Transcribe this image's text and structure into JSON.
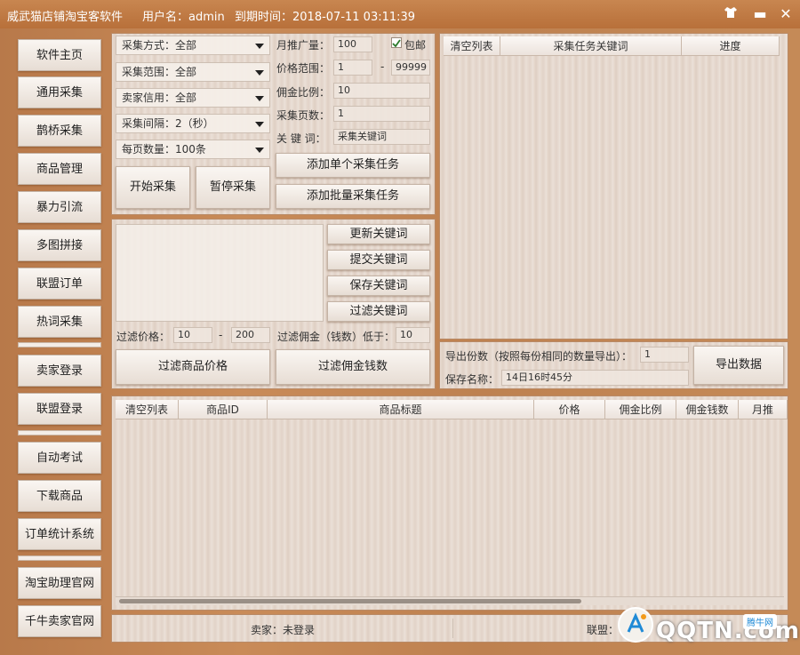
{
  "window": {
    "title": "威武猫店铺淘宝客软件",
    "user_text": "用户名：admin",
    "expire_text": "到期时间：2018-07-11 03:11:39"
  },
  "sidebar": {
    "items": [
      "软件主页",
      "通用采集",
      "鹊桥采集",
      "商品管理",
      "暴力引流",
      "多图拼接",
      "联盟订单",
      "热词采集",
      "卖家登录",
      "联盟登录",
      "自动考试",
      "下载商品",
      "订单统计系统",
      "淘宝助理官网",
      "千牛卖家官网"
    ]
  },
  "collect": {
    "selects": [
      {
        "value": "采集方式：全部"
      },
      {
        "value": "采集范围：全部"
      },
      {
        "value": "卖家信用：全部"
      },
      {
        "value": "采集间隔：2（秒）"
      },
      {
        "value": "每页数量：100条"
      }
    ],
    "start_button": "开始采集",
    "pause_button": "暂停采集",
    "monthly_promo_label": "月推广量：",
    "monthly_promo_value": "100",
    "free_ship_label": "包邮",
    "price_range_label": "价格范围：",
    "price_min": "1",
    "price_dash": "-",
    "price_max": "99999",
    "commission_label": "佣金比例：",
    "commission_value": "10",
    "pages_label": "采集页数：",
    "pages_value": "1",
    "keyword_label": "关 键 词：",
    "keyword_value": "采集关键词",
    "add_single_button": "添加单个采集任务",
    "add_batch_button": "添加批量采集任务"
  },
  "keywords": {
    "update_button": "更新关键词",
    "submit_button": "提交关键词",
    "save_button": "保存关键词",
    "filter_button": "过滤关键词"
  },
  "filter": {
    "price_label": "过滤价格：",
    "price_min": "10",
    "price_dash": "-",
    "price_max": "200",
    "commission_label": "过滤佣金（钱数）低于：",
    "commission_value": "10",
    "price_button": "过滤商品价格",
    "commission_button": "过滤佣金钱数"
  },
  "task_table": {
    "headers": [
      "清空列表",
      "采集任务关键词",
      "进度"
    ]
  },
  "export": {
    "count_label": "导出份数（按照每份相同的数量导出）：",
    "count_value": "1",
    "name_label": "保存名称：",
    "name_value": "14日16时45分",
    "export_button": "导出数据"
  },
  "product_table": {
    "headers": [
      "清空列表",
      "商品ID",
      "商品标题",
      "价格",
      "佣金比例",
      "佣金钱数",
      "月推"
    ]
  },
  "status": {
    "seller": "卖家：未登录",
    "union": "联盟："
  },
  "watermark": {
    "text": "QQTN.com",
    "badge": "腾牛网"
  }
}
